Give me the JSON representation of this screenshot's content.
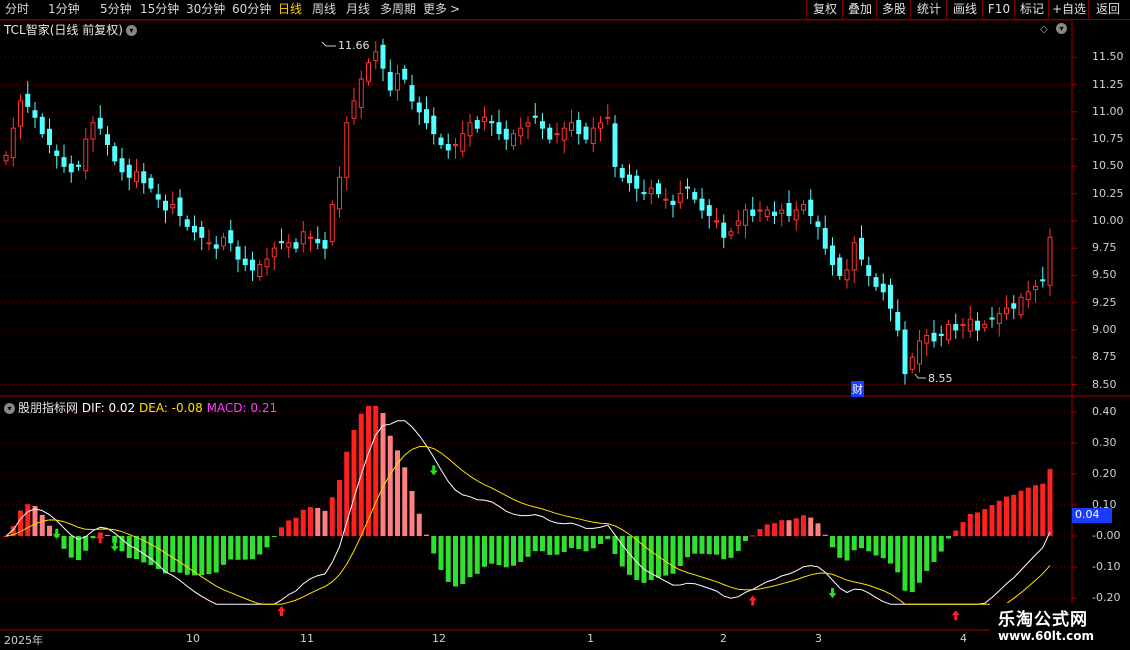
{
  "toolbar": {
    "periods": [
      "分时",
      "1分钟",
      "5分钟",
      "15分钟",
      "30分钟",
      "60分钟",
      "日线",
      "周线",
      "月线",
      "多周期",
      "更多"
    ],
    "active": "日线",
    "more_arrow": ">",
    "right_buttons": [
      "复权",
      "叠加",
      "多股",
      "统计",
      "画线",
      "F10",
      "标记",
      "+自选",
      "返回"
    ]
  },
  "main_chart": {
    "title": "TCL智家(日线 前复权)",
    "high_label": "11.66",
    "low_label": "8.55",
    "cai_badge": "财",
    "y_ticks": [
      "11.50",
      "11.25",
      "11.00",
      "10.75",
      "10.50",
      "10.25",
      "10.00",
      "9.75",
      "9.50",
      "9.25",
      "9.00",
      "8.75",
      "8.50"
    ]
  },
  "indicator": {
    "name": "股朋指标网",
    "dif_label": "DIF: 0.02",
    "dea_label": "DEA: -0.08",
    "macd_label": "MACD: 0.21",
    "y_ticks": [
      "0.40",
      "0.30",
      "0.20",
      "0.10",
      "-0.00",
      "-0.10",
      "-0.20"
    ],
    "current_value": "0.04"
  },
  "x_axis": {
    "labels": [
      "2025年",
      "10",
      "11",
      "12",
      "1",
      "2",
      "3",
      "4"
    ]
  },
  "watermark": {
    "line1": "乐淘公式网",
    "line2": "www.60lt.com"
  },
  "colors": {
    "up": "#ff3232",
    "down": "#54ffff",
    "dif": "#ffffff",
    "dea": "#ffe000",
    "hist_pos": "#ff2020",
    "hist_pos_light": "#ff8080",
    "hist_neg": "#30e030",
    "grid": "#7a0000"
  },
  "chart_data": {
    "type": "candlestick",
    "ylim": [
      8.45,
      11.75
    ],
    "closes": [
      10.6,
      10.85,
      11.1,
      11.05,
      10.95,
      10.8,
      10.7,
      10.6,
      10.5,
      10.45,
      10.5,
      10.75,
      10.9,
      10.85,
      10.7,
      10.55,
      10.45,
      10.4,
      10.45,
      10.35,
      10.3,
      10.2,
      10.1,
      10.15,
      10.05,
      9.95,
      9.9,
      9.85,
      9.8,
      9.75,
      9.85,
      9.8,
      9.65,
      9.6,
      9.55,
      9.6,
      9.65,
      9.75,
      9.8,
      9.8,
      9.75,
      9.9,
      9.85,
      9.8,
      9.75,
      10.15,
      10.4,
      10.9,
      11.1,
      11.3,
      11.45,
      11.55,
      11.4,
      11.2,
      11.35,
      11.3,
      11.1,
      11.0,
      10.9,
      10.8,
      10.7,
      10.65,
      10.7,
      10.8,
      10.9,
      10.85,
      10.95,
      10.9,
      10.8,
      10.75,
      10.8,
      10.85,
      10.9,
      10.95,
      10.85,
      10.75,
      10.8,
      10.85,
      10.9,
      10.8,
      10.75,
      10.85,
      10.9,
      10.95,
      10.5,
      10.4,
      10.35,
      10.3,
      10.25,
      10.3,
      10.25,
      10.2,
      10.15,
      10.25,
      10.3,
      10.2,
      10.1,
      10.05,
      10.0,
      9.85,
      9.9,
      10.0,
      10.1,
      10.05,
      10.1,
      10.1,
      10.05,
      10.1,
      10.05,
      10.1,
      10.15,
      10.05,
      9.95,
      9.75,
      9.6,
      9.5,
      9.55,
      9.8,
      9.65,
      9.5,
      9.4,
      9.35,
      9.2,
      9.0,
      8.6,
      8.75,
      8.9,
      8.95,
      8.9,
      8.95,
      9.05,
      9.0,
      9.05,
      9.1,
      9.0,
      9.05,
      9.1,
      9.15,
      9.2,
      9.2,
      9.3,
      9.35,
      9.4,
      9.45,
      9.85
    ]
  }
}
